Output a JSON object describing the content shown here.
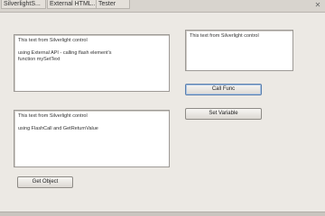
{
  "tabs": [
    {
      "label": "SilverlightS..."
    },
    {
      "label": "External HTML..."
    },
    {
      "label": "Tester"
    }
  ],
  "window": {
    "close_glyph": "✕"
  },
  "panel_top_left": {
    "line1": "This text from Silverlight control",
    "line2": "using External API - calling flash element's",
    "line3": "function mySetText"
  },
  "panel_right": {
    "line1": "This text from Silverlight control"
  },
  "panel_bottom_left": {
    "line1": "This text from Silverlight control",
    "line2": "using FlashCall and GetReturnValue"
  },
  "buttons": {
    "call_func": "Call Func",
    "set_variable": "Set Variable",
    "get_object": "Get Object"
  }
}
